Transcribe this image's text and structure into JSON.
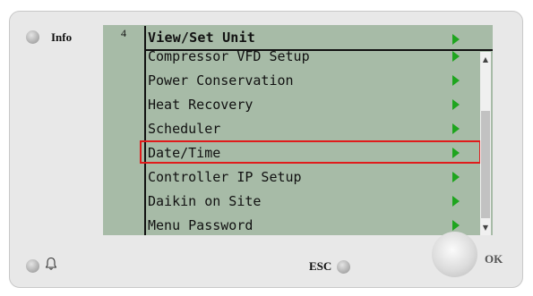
{
  "panel": {
    "info_label": "Info",
    "esc_label": "ESC",
    "ok_label": "OK"
  },
  "menu": {
    "index": "4",
    "title": "View/Set Unit",
    "items": [
      {
        "label": "Compressor VFD Setup"
      },
      {
        "label": "Power Conservation"
      },
      {
        "label": "Heat Recovery"
      },
      {
        "label": "Scheduler"
      },
      {
        "label": "Date/Time",
        "highlighted": true
      },
      {
        "label": "Controller IP Setup"
      },
      {
        "label": "Daikin on Site"
      },
      {
        "label": "Menu Password"
      }
    ]
  },
  "icons": {
    "arrow": "right-arrow-icon",
    "bell": "bell-icon",
    "scroll_up": "chevron-up-icon",
    "scroll_down": "chevron-down-icon"
  },
  "colors": {
    "screen_bg": "#a7bba7",
    "arrow": "#1ea51e",
    "highlight": "#e01b1b"
  }
}
